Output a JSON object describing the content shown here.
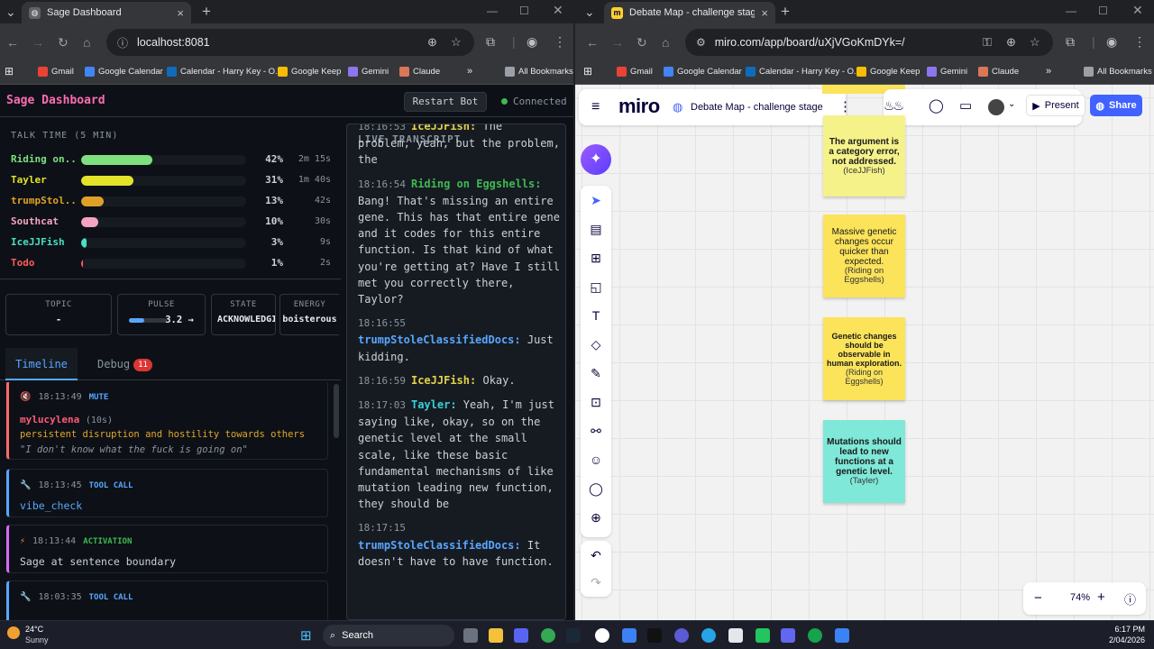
{
  "left_browser": {
    "tab_title": "Sage Dashboard",
    "url": "localhost:8081",
    "bookmarks": [
      "Gmail",
      "Google Calendar",
      "Calendar - Harry Key - O...",
      "Google Keep",
      "Gemini",
      "Claude"
    ],
    "all_bookmarks": "All Bookmarks"
  },
  "right_browser": {
    "tab_title": "Debate Map - challenge stage - Miro",
    "url": "miro.com/app/board/uXjVGoKmDYk=/",
    "bookmarks": [
      "Gmail",
      "Google Calendar",
      "Calendar - Harry Key - O...",
      "Google Keep",
      "Gemini",
      "Claude"
    ],
    "all_bookmarks": "All Bookmarks"
  },
  "sage": {
    "title": "Sage Dashboard",
    "restart_label": "Restart Bot",
    "status": "Connected",
    "talk_time_title": "TALK TIME (5 MIN)",
    "speakers": [
      {
        "name": "Riding on...",
        "pct_label": "42%",
        "share": 0.42,
        "duration": "2m 15s",
        "color": "#7ee07e"
      },
      {
        "name": "Tayler",
        "pct_label": "31%",
        "share": 0.31,
        "duration": "1m 40s",
        "color": "#e3e32a"
      },
      {
        "name": "trumpStol...",
        "pct_label": "13%",
        "share": 0.13,
        "duration": "42s",
        "color": "#e0a028"
      },
      {
        "name": "Southcat",
        "pct_label": "10%",
        "share": 0.1,
        "duration": "30s",
        "color": "#f4a3c0"
      },
      {
        "name": "IceJJFish",
        "pct_label": "3%",
        "share": 0.03,
        "duration": "9s",
        "color": "#4ae0c0"
      },
      {
        "name": "Todo",
        "pct_label": "1%",
        "share": 0.01,
        "duration": "2s",
        "color": "#ff5a5a"
      }
    ],
    "stats": {
      "topic_label": "TOPIC",
      "topic": "-",
      "pulse_label": "PULSE",
      "pulse": "3.2 →",
      "state_label": "STATE",
      "state": "ACKNOWLEDGING",
      "energy_label": "ENERGY",
      "energy": "boisterous"
    },
    "tabs": {
      "timeline": "Timeline",
      "debug": "Debug",
      "debug_count": "11"
    },
    "timeline": [
      {
        "time": "18:13:49",
        "kind": "MUTE",
        "user": "mylucylena",
        "user_extra": "(10s)",
        "reason": "persistent disruption and hostility towards others",
        "quote": "\"I don't know what the fuck is going on\""
      },
      {
        "time": "18:13:45",
        "kind": "TOOL CALL",
        "detail": "vibe_check"
      },
      {
        "time": "18:13:44",
        "kind": "ACTIVATION",
        "detail": "Sage at sentence boundary"
      },
      {
        "time": "18:03:35",
        "kind": "TOOL CALL",
        "detail": ""
      }
    ],
    "transcript_title": "LIVE TRANSCRIPT",
    "transcript": [
      {
        "time": "18:16:53",
        "speaker": "IceJJFish:",
        "text": "The problem, yeah, but the problem, the"
      },
      {
        "time": "18:16:54",
        "speaker": "Riding on Eggshells:",
        "text": "Bang! That's missing an entire gene. This has that entire gene and it codes for this entire function. Is that kind of what you're getting at? Have I still met you correctly there, Taylor?"
      },
      {
        "time": "18:16:55",
        "speaker": "trumpStoleClassifiedDocs:",
        "text": "Just kidding."
      },
      {
        "time": "18:16:59",
        "speaker": "IceJJFish:",
        "text": "Okay."
      },
      {
        "time": "18:17:03",
        "speaker": "Tayler:",
        "text": "Yeah, I'm just saying like, okay, so on the genetic level at the small scale, like these basic fundamental mechanisms of like mutation leading new function, they should be"
      },
      {
        "time": "18:17:15",
        "speaker": "trumpStoleClassifiedDocs:",
        "text": "It doesn't have to have function."
      }
    ]
  },
  "miro": {
    "logo": "miro",
    "board_title": "Debate Map - challenge stage",
    "present": "Present",
    "share": "Share",
    "zoom": "74%",
    "stickies": [
      {
        "text": "The argument is a category error, not addressed.",
        "author": "(IceJJFish)",
        "color": "#f5f28a"
      },
      {
        "text": "Massive genetic changes occur quicker than expected.",
        "author": "(Riding on Eggshells)",
        "color": "#fbe35a"
      },
      {
        "text": "Genetic changes should be observable in human exploration.",
        "author": "(Riding on Eggshells)",
        "color": "#fbe35a"
      },
      {
        "text": "Mutations should lead to new functions at a genetic level.",
        "author": "(Tayler)",
        "color": "#7fe8d8"
      }
    ]
  },
  "taskbar": {
    "weather_temp": "24°C",
    "weather_desc": "Sunny",
    "search": "Search",
    "time": "6:17 PM",
    "date": "2/04/2026"
  }
}
